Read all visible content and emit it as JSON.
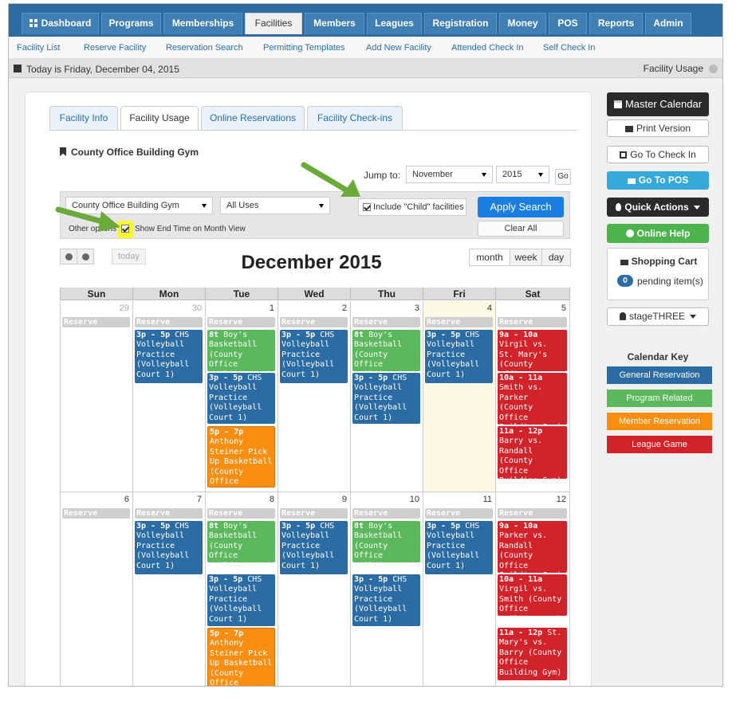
{
  "topnav": {
    "tabs": [
      {
        "label": "Dashboard",
        "active": false
      },
      {
        "label": "Programs",
        "active": false
      },
      {
        "label": "Memberships",
        "active": false
      },
      {
        "label": "Facilities",
        "active": true
      },
      {
        "label": "Members",
        "active": false
      },
      {
        "label": "Leagues",
        "active": false
      },
      {
        "label": "Registration",
        "active": false
      },
      {
        "label": "Money",
        "active": false
      },
      {
        "label": "POS",
        "active": false
      },
      {
        "label": "Reports",
        "active": false
      },
      {
        "label": "Admin",
        "active": false
      }
    ]
  },
  "subnav": {
    "links": [
      "Facility List",
      "Reserve Facility",
      "Reservation Search",
      "Permitting Templates",
      "Add New Facility",
      "Attended Check In",
      "Self Check In"
    ]
  },
  "infobar": {
    "today": "Today is Friday, December 04, 2015",
    "section": "Facility Usage"
  },
  "tabs": [
    "Facility Info",
    "Facility Usage",
    "Online Reservations",
    "Facility Check-ins"
  ],
  "active_tab": "Facility Usage",
  "facility_title": "County Office Building Gym",
  "jump": {
    "label": "Jump to:",
    "month": "November",
    "year": "2015",
    "go": "Go"
  },
  "search": {
    "facility": "County Office Building Gym",
    "uses": "All Uses",
    "include_child_label": "Include \"Child\" facilities",
    "include_child_checked": true,
    "apply": "Apply Search",
    "clear": "Clear All",
    "other_options": "Other options:",
    "show_end_label": "Show End Time on Month View",
    "show_end_checked": true
  },
  "calendar": {
    "today_btn": "today",
    "title": "December 2015",
    "views": [
      "month",
      "week",
      "day"
    ],
    "active_view": "month",
    "weekdays": [
      "Sun",
      "Mon",
      "Tue",
      "Wed",
      "Thu",
      "Fri",
      "Sat"
    ],
    "reserve_label": "Reserve",
    "week1_days": [
      "29",
      "30",
      "1",
      "2",
      "3",
      "4",
      "5"
    ],
    "week2_days": [
      "6",
      "7",
      "8",
      "9",
      "10",
      "11",
      "12"
    ],
    "events": {
      "vb_time": "3p - 5p",
      "vb_text": "CHS Volleyball Practice (Volleyball Court 1)",
      "bb_time": "8t",
      "bb_text": "Boy's Basketball (County Office Building Gym)",
      "pu_time": "5p - 7p",
      "pu_text": "Anthony Steiner Pick Up Basketball (County Office Building Gym)",
      "sat1_a_time": "9a - 10a",
      "sat1_a_text": "Virgil vs. St. Mary's (County Office Building Gym)",
      "sat1_b_time": "10a - 11a",
      "sat1_b_text": "Smith vs. Parker (County Office Building Gym)",
      "sat1_c_time": "11a - 12p",
      "sat1_c_text": "Barry vs. Randall (County Office Building Gym)",
      "sat2_a_time": "9a - 10a",
      "sat2_a_text": "Parker vs. Randall (County Office Building Gym)",
      "sat2_b_time": "10a - 11a",
      "sat2_b_text": "Virgil vs. Smith (County Office Building Gym)",
      "sat2_c_time": "11a - 12p",
      "sat2_c_text": "St. Mary's vs. Barry (County Office Building Gym)"
    }
  },
  "sidebar": {
    "master_calendar": "Master Calendar",
    "print_version": "Print Version",
    "go_check_in": "Go To Check In",
    "go_pos": "Go To POS",
    "quick_actions": "Quick Actions",
    "online_help": "Online Help",
    "cart_title": "Shopping Cart",
    "cart_count": "0",
    "cart_pending": "pending item(s)",
    "user": "stageTHREE"
  },
  "calendar_key": {
    "title": "Calendar Key",
    "items": [
      {
        "label": "General Reservation",
        "color": "#2c6ca4"
      },
      {
        "label": "Program Related",
        "color": "#5cb85c"
      },
      {
        "label": "Member Reservation",
        "color": "#f98e10"
      },
      {
        "label": "League Game",
        "color": "#d2232a"
      }
    ]
  },
  "colors": {
    "nav_blue": "#2d6ca2",
    "apply_blue": "#1a7ee0",
    "highlight_yellow": "#f7f733",
    "arrow_green": "#6aaa3a"
  }
}
